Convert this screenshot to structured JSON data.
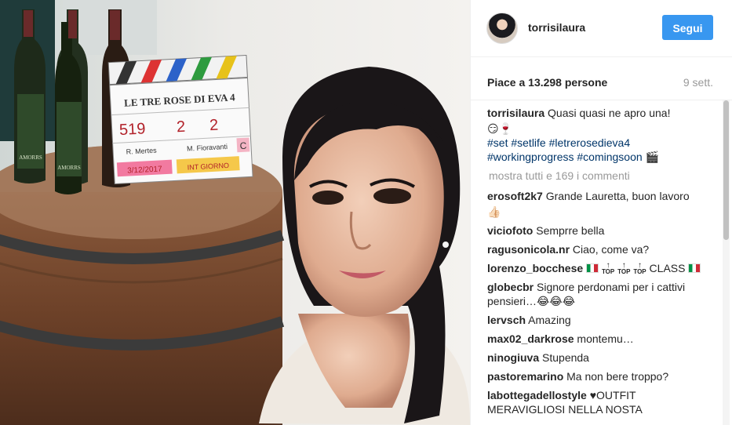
{
  "post": {
    "username": "torrisilaura",
    "follow_label": "Segui",
    "likes": "Piace a 13.298 persone",
    "time_ago": "9 sett.",
    "caption_user": "torrisilaura",
    "caption_text": "Quasi quasi ne apro una!",
    "caption_emoji": "😏🍷",
    "hashtags_line1": "#set #setlife #letrerosedieva4",
    "hashtags_line2": "#workingprogress #comingsoon 🎬",
    "show_all": "mostra tutti e 169 i commenti"
  },
  "photo": {
    "clapper_title": "LE TRE ROSE DI EVA 4",
    "clapper_scene": "519",
    "clapper_take1": "2",
    "clapper_take2": "2",
    "clapper_director": "R. Mertes",
    "clapper_dop": "M. Fioravanti",
    "clapper_c": "C",
    "clapper_date": "3/12/2017",
    "clapper_int": "INT GIORNO",
    "bottle_label": "AMORRS"
  },
  "comments": [
    {
      "user": "erosoft2k7",
      "text": "Grande Lauretta, buon lavoro",
      "line2": "👍🏻"
    },
    {
      "user": "viciofoto",
      "text": "Semprre bella"
    },
    {
      "user": "ragusonicola.nr",
      "text": "Ciao, come va?"
    },
    {
      "user": "lorenzo_bocchese",
      "text": "CLASS"
    },
    {
      "user": "globecbr",
      "text": "Signore perdonami per i cattivi",
      "line2": "pensieri…😂😂😂"
    },
    {
      "user": "lervsch",
      "text": "Amazing"
    },
    {
      "user": "max02_darkrose",
      "text": "montemu…"
    },
    {
      "user": "ninogiuva",
      "text": "Stupenda"
    },
    {
      "user": "pastoremarino",
      "text": "Ma non bere troppo?"
    },
    {
      "user": "labottegadellostyle",
      "text": "♥OUTFIT",
      "line2": "MERAVIGLIOSI NELLA NOSTA"
    }
  ],
  "top_badge": "TOP"
}
